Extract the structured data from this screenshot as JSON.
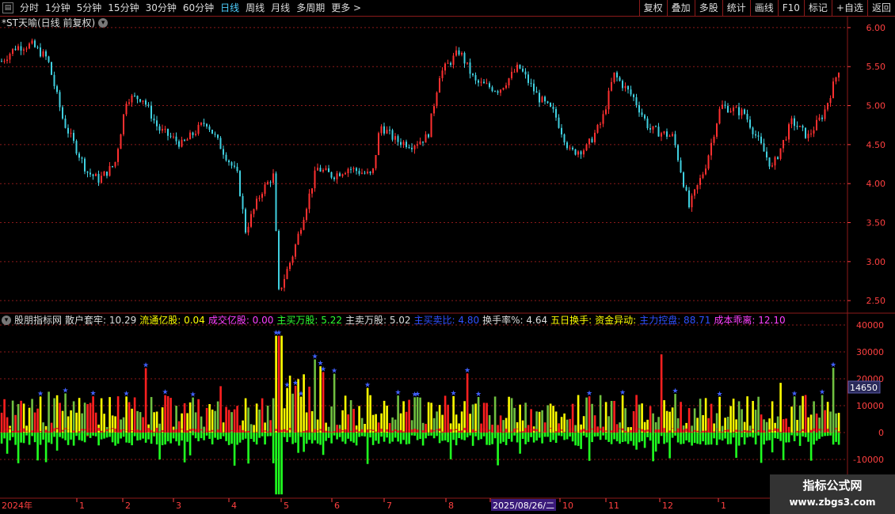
{
  "toolbar": {
    "timeframes": [
      "分时",
      "1分钟",
      "5分钟",
      "15分钟",
      "30分钟",
      "60分钟",
      "日线",
      "周线",
      "月线",
      "多周期",
      "更多 >"
    ],
    "active": "日线",
    "right_buttons": [
      "复权",
      "叠加",
      "多股",
      "统计",
      "画线",
      "F10",
      "标记",
      "+自选",
      "返回"
    ]
  },
  "chart_title": "*ST天喻(日线 前复权)",
  "price_axis": [
    "6.00",
    "5.50",
    "5.00",
    "4.50",
    "4.00",
    "3.50",
    "3.00",
    "2.50"
  ],
  "volume_axis": [
    "40000",
    "30000",
    "20000",
    "10000",
    "0",
    "-10000"
  ],
  "volume_highlight": "14650",
  "indicator": {
    "name": "股朋指标网",
    "items": [
      {
        "label": "散户套牢:",
        "value": "10.29",
        "color": "#dddddd"
      },
      {
        "label": "流通亿股:",
        "value": "0.04",
        "color": "#ffff00"
      },
      {
        "label": "成交亿股:",
        "value": "0.00",
        "color": "#ff40ff"
      },
      {
        "label": "主买万股:",
        "value": "5.22",
        "color": "#30ff30"
      },
      {
        "label": "主卖万股:",
        "value": "5.02",
        "color": "#dddddd"
      },
      {
        "label": "主买卖比:",
        "value": "4.80",
        "color": "#3050ff"
      },
      {
        "label": "换手率%:",
        "value": "4.64",
        "color": "#dddddd"
      },
      {
        "label": "五日换手:",
        "value": "",
        "color": "#ffff00"
      },
      {
        "label": "资金异动:",
        "value": "",
        "color": "#ffff00"
      },
      {
        "label": "主力控盘:",
        "value": "88.71",
        "color": "#3050ff"
      },
      {
        "label": "成本乖离:",
        "value": "12.10",
        "color": "#ff40ff"
      }
    ]
  },
  "date_axis": [
    "2024年",
    "1",
    "2",
    "3",
    "4",
    "5",
    "6",
    "7",
    "8",
    "2025/08/26/二",
    "10",
    "11",
    "12",
    "1"
  ],
  "watermark": {
    "line1": "指标公式网",
    "line2": "www.zbgs3.com"
  },
  "colors": {
    "up": "#ff3030",
    "down": "#40d0e0",
    "grid": "#8b1a1a",
    "buy": "#ffff00",
    "sell": "#20ff20",
    "mid": "#ff2020"
  }
}
